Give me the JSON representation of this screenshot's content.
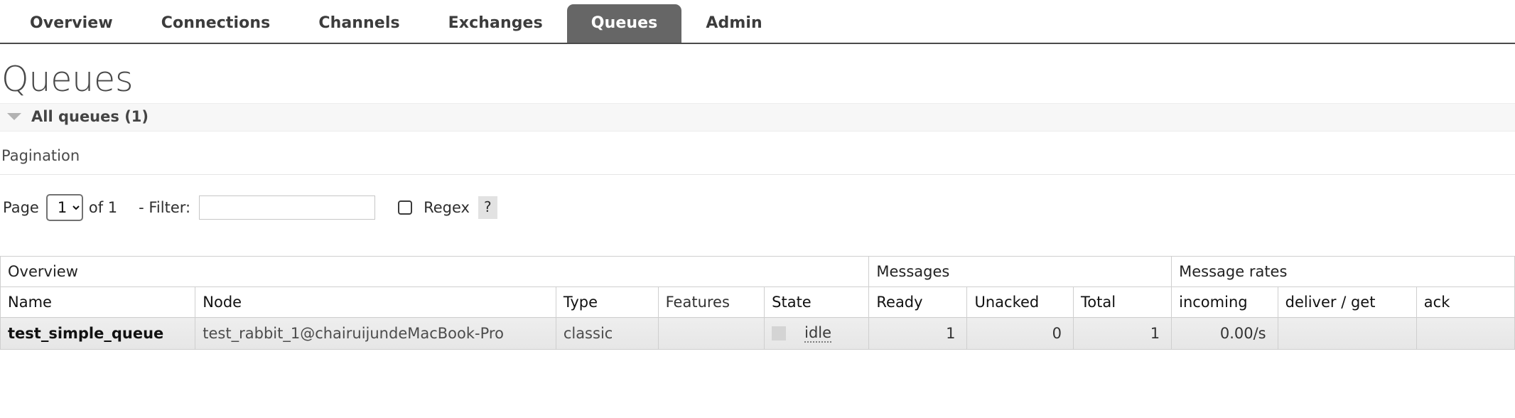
{
  "nav": {
    "tabs": [
      {
        "label": "Overview",
        "active": false
      },
      {
        "label": "Connections",
        "active": false
      },
      {
        "label": "Channels",
        "active": false
      },
      {
        "label": "Exchanges",
        "active": false
      },
      {
        "label": "Queues",
        "active": true
      },
      {
        "label": "Admin",
        "active": false
      }
    ]
  },
  "page": {
    "title": "Queues"
  },
  "section": {
    "label": "All queues (1)",
    "expanded": true,
    "toggle_icon": "triangle-down-icon"
  },
  "pagination": {
    "title": "Pagination",
    "page_label": "Page",
    "page_value": "1",
    "page_options": [
      "1"
    ],
    "of_label": "of 1",
    "filter_label": "- Filter:",
    "filter_value": "",
    "filter_placeholder": "",
    "regex_label": "Regex",
    "regex_checked": false,
    "help_label": "?"
  },
  "table": {
    "group_headers": [
      {
        "label": "Overview",
        "span": 5
      },
      {
        "label": "Messages",
        "span": 3
      },
      {
        "label": "Message rates",
        "span": 3
      }
    ],
    "columns": [
      {
        "label": "Name",
        "sortable": true,
        "align": "left"
      },
      {
        "label": "Node",
        "sortable": true,
        "align": "left"
      },
      {
        "label": "Type",
        "sortable": true,
        "align": "left"
      },
      {
        "label": "Features",
        "sortable": false,
        "align": "left"
      },
      {
        "label": "State",
        "sortable": true,
        "align": "left"
      },
      {
        "label": "Ready",
        "sortable": true,
        "align": "left"
      },
      {
        "label": "Unacked",
        "sortable": true,
        "align": "left"
      },
      {
        "label": "Total",
        "sortable": true,
        "align": "left"
      },
      {
        "label": "incoming",
        "sortable": true,
        "align": "left"
      },
      {
        "label": "deliver / get",
        "sortable": true,
        "align": "left"
      },
      {
        "label": "ack",
        "sortable": true,
        "align": "left"
      }
    ],
    "rows": [
      {
        "name": "test_simple_queue",
        "node": "test_rabbit_1@chairuijundeMacBook-Pro",
        "type": "classic",
        "features": "",
        "state": "idle",
        "state_color": "#d4d4d4",
        "ready": "1",
        "unacked": "0",
        "total": "1",
        "incoming": "0.00/s",
        "deliver_get": "",
        "ack": ""
      }
    ]
  }
}
